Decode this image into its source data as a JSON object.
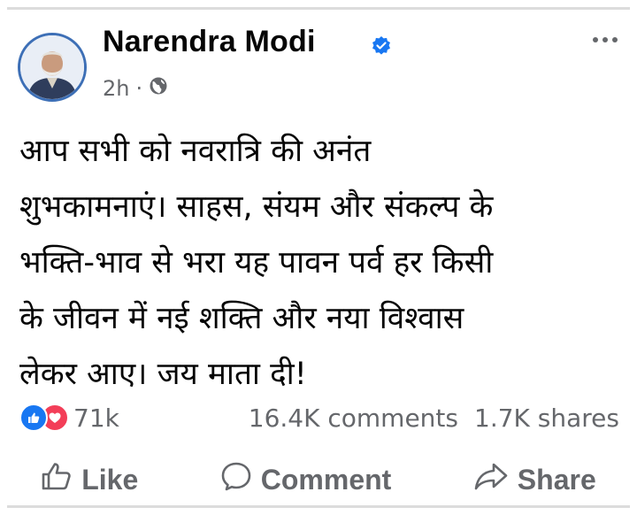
{
  "post": {
    "author_name": "Narendra Modi",
    "timestamp": "2h",
    "separator": "·",
    "audience_icon": "globe-icon",
    "body": "आप सभी को नवरात्रि की अनंत\nशुभकामनाएं। साहस, संयम और संकल्प के\nभक्ति-भाव से भरा यह पावन पर्व हर किसी\nके जीवन में नई शक्ति और नया विश्वास\nलेकर आए। जय माता दी!"
  },
  "stats": {
    "reaction_icons": [
      "like-reaction-icon",
      "love-reaction-icon"
    ],
    "reactions_count": "71k",
    "comments": "16.4K comments",
    "shares": "1.7K shares"
  },
  "actions": {
    "like": "Like",
    "comment": "Comment",
    "share": "Share"
  },
  "colors": {
    "like_blue": "#1877f2",
    "love_red": "#f33e58",
    "secondary_text": "#65676b"
  }
}
